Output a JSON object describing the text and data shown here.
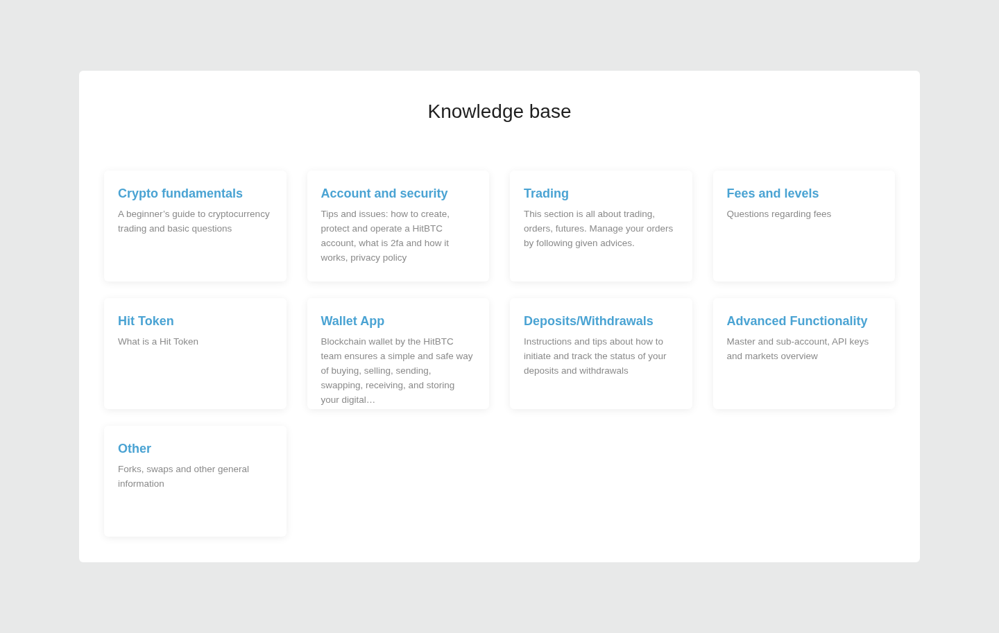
{
  "page": {
    "title": "Knowledge base"
  },
  "categories": [
    {
      "title": "Crypto fundamentals",
      "description": "A beginner’s guide to cryptocurrency trading and basic questions"
    },
    {
      "title": "Account and security",
      "description": "Tips and issues: how to create, protect and operate a HitBTC account, what is 2fa and how it works, privacy policy"
    },
    {
      "title": "Trading",
      "description": "This section is all about trading, orders, futures. Manage your orders by following given advices."
    },
    {
      "title": "Fees and levels",
      "description": "Questions regarding fees"
    },
    {
      "title": "Hit Token",
      "description": "What is a Hit Token"
    },
    {
      "title": "Wallet App",
      "description": "Blockchain wallet by the HitBTC team ensures a simple and safe way of buying, selling, sending, swapping, receiving, and storing your digital…"
    },
    {
      "title": "Deposits/Withdrawals",
      "description": "Instructions and tips about how to initiate and track the status of your deposits and withdrawals"
    },
    {
      "title": "Advanced Functionality",
      "description": "Master and sub-account, API keys and markets overview"
    },
    {
      "title": "Other",
      "description": "Forks, swaps and other general information"
    }
  ]
}
